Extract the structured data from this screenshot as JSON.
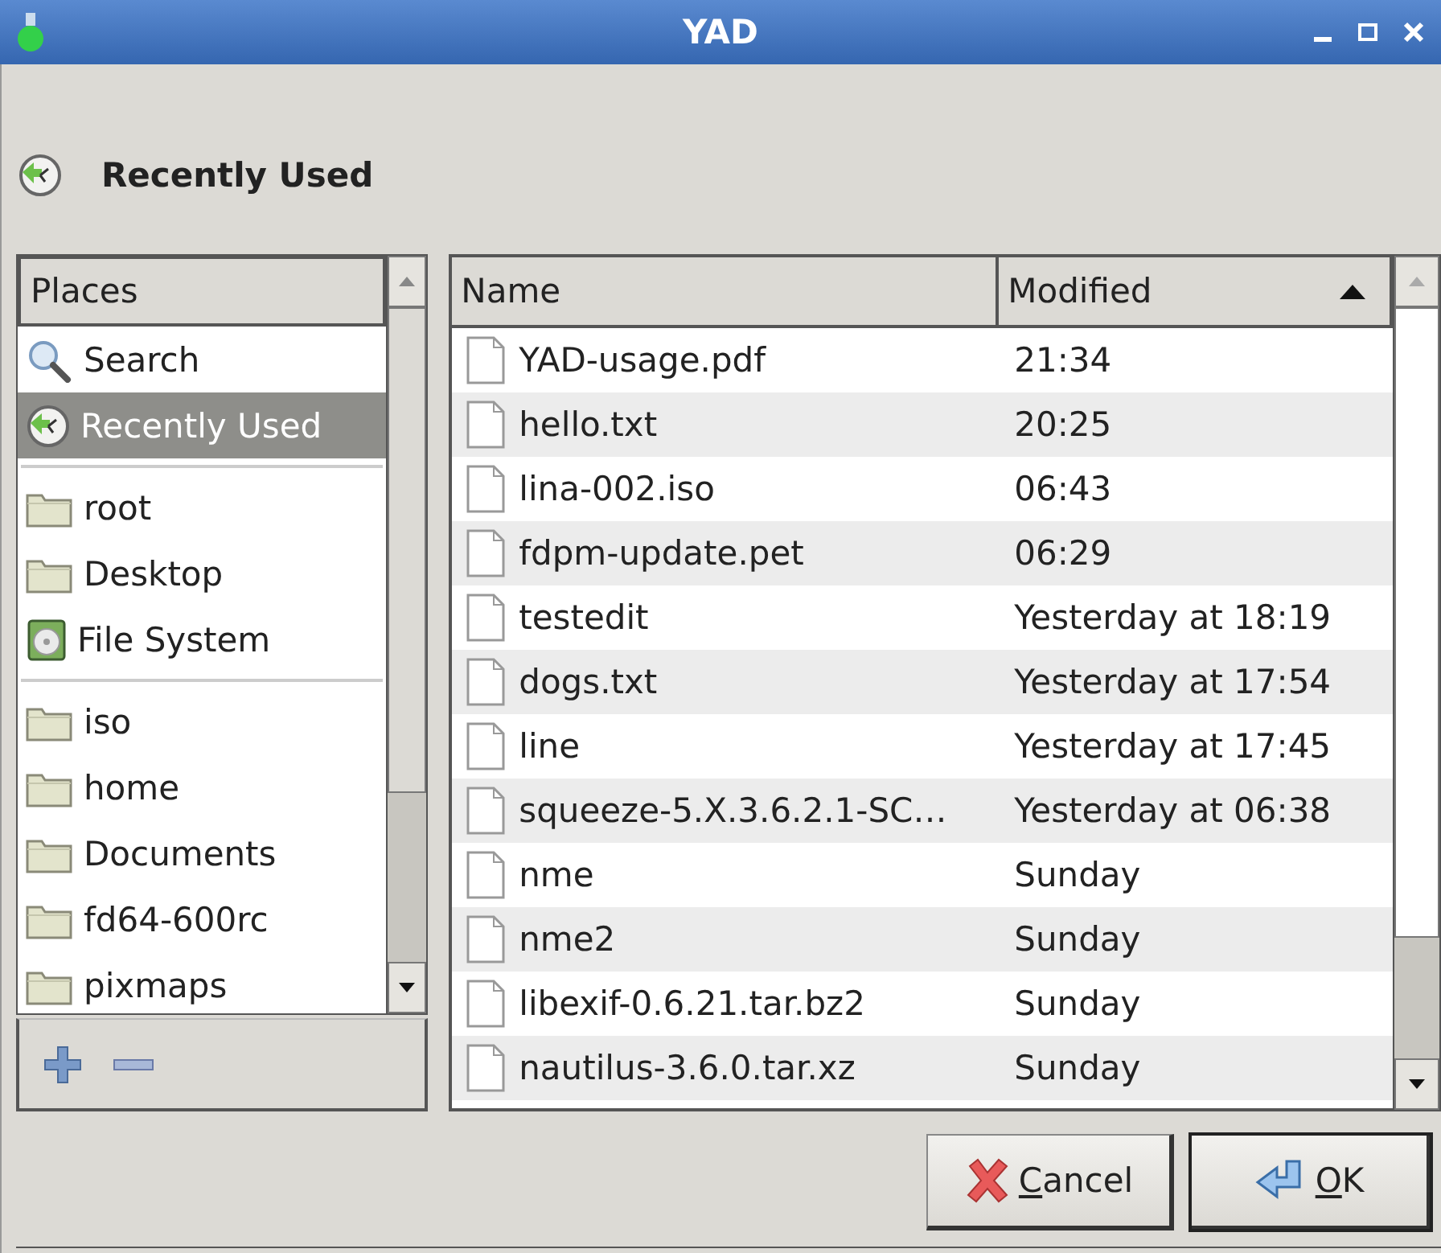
{
  "window": {
    "title": "YAD"
  },
  "location": {
    "label": "Recently Used",
    "kind": "recent"
  },
  "places": {
    "heading": "Places",
    "groups": [
      [
        {
          "label": "Search",
          "kind": "search",
          "selected": false
        },
        {
          "label": "Recently Used",
          "kind": "recent",
          "selected": true
        }
      ],
      [
        {
          "label": "root",
          "kind": "folder",
          "selected": false
        },
        {
          "label": "Desktop",
          "kind": "folder",
          "selected": false
        },
        {
          "label": "File System",
          "kind": "drive",
          "selected": false
        }
      ],
      [
        {
          "label": "iso",
          "kind": "folder",
          "selected": false
        },
        {
          "label": "home",
          "kind": "folder",
          "selected": false
        },
        {
          "label": "Documents",
          "kind": "folder",
          "selected": false
        },
        {
          "label": "fd64-600rc",
          "kind": "folder",
          "selected": false
        },
        {
          "label": "pixmaps",
          "kind": "folder",
          "selected": false
        }
      ]
    ]
  },
  "files": {
    "columns": [
      {
        "label": "Name",
        "sorted": false
      },
      {
        "label": "Modified",
        "sorted": true
      }
    ],
    "rows": [
      {
        "name": "YAD-usage.pdf",
        "modified": "21:34",
        "selected": false
      },
      {
        "name": "hello.txt",
        "modified": "20:25",
        "selected": false
      },
      {
        "name": "lina-002.iso",
        "modified": "06:43",
        "selected": false
      },
      {
        "name": "fdpm-update.pet",
        "modified": "06:29",
        "selected": false
      },
      {
        "name": "testedit",
        "modified": "Yesterday at 18:19",
        "selected": false
      },
      {
        "name": "dogs.txt",
        "modified": "Yesterday at 17:54",
        "selected": false
      },
      {
        "name": "line",
        "modified": "Yesterday at 17:45",
        "selected": false
      },
      {
        "name": "squeeze-5.X.3.6.2.1-SC…",
        "modified": "Yesterday at 06:38",
        "selected": false
      },
      {
        "name": "nme",
        "modified": "Sunday",
        "selected": false
      },
      {
        "name": "nme2",
        "modified": "Sunday",
        "selected": false
      },
      {
        "name": "libexif-0.6.21.tar.bz2",
        "modified": "Sunday",
        "selected": false
      },
      {
        "name": "nautilus-3.6.0.tar.xz",
        "modified": "Sunday",
        "selected": false
      }
    ]
  },
  "buttons": [
    {
      "label": "Cancel",
      "kind": "cancel",
      "default": false
    },
    {
      "label": "OK",
      "kind": "ok",
      "default": true
    }
  ]
}
